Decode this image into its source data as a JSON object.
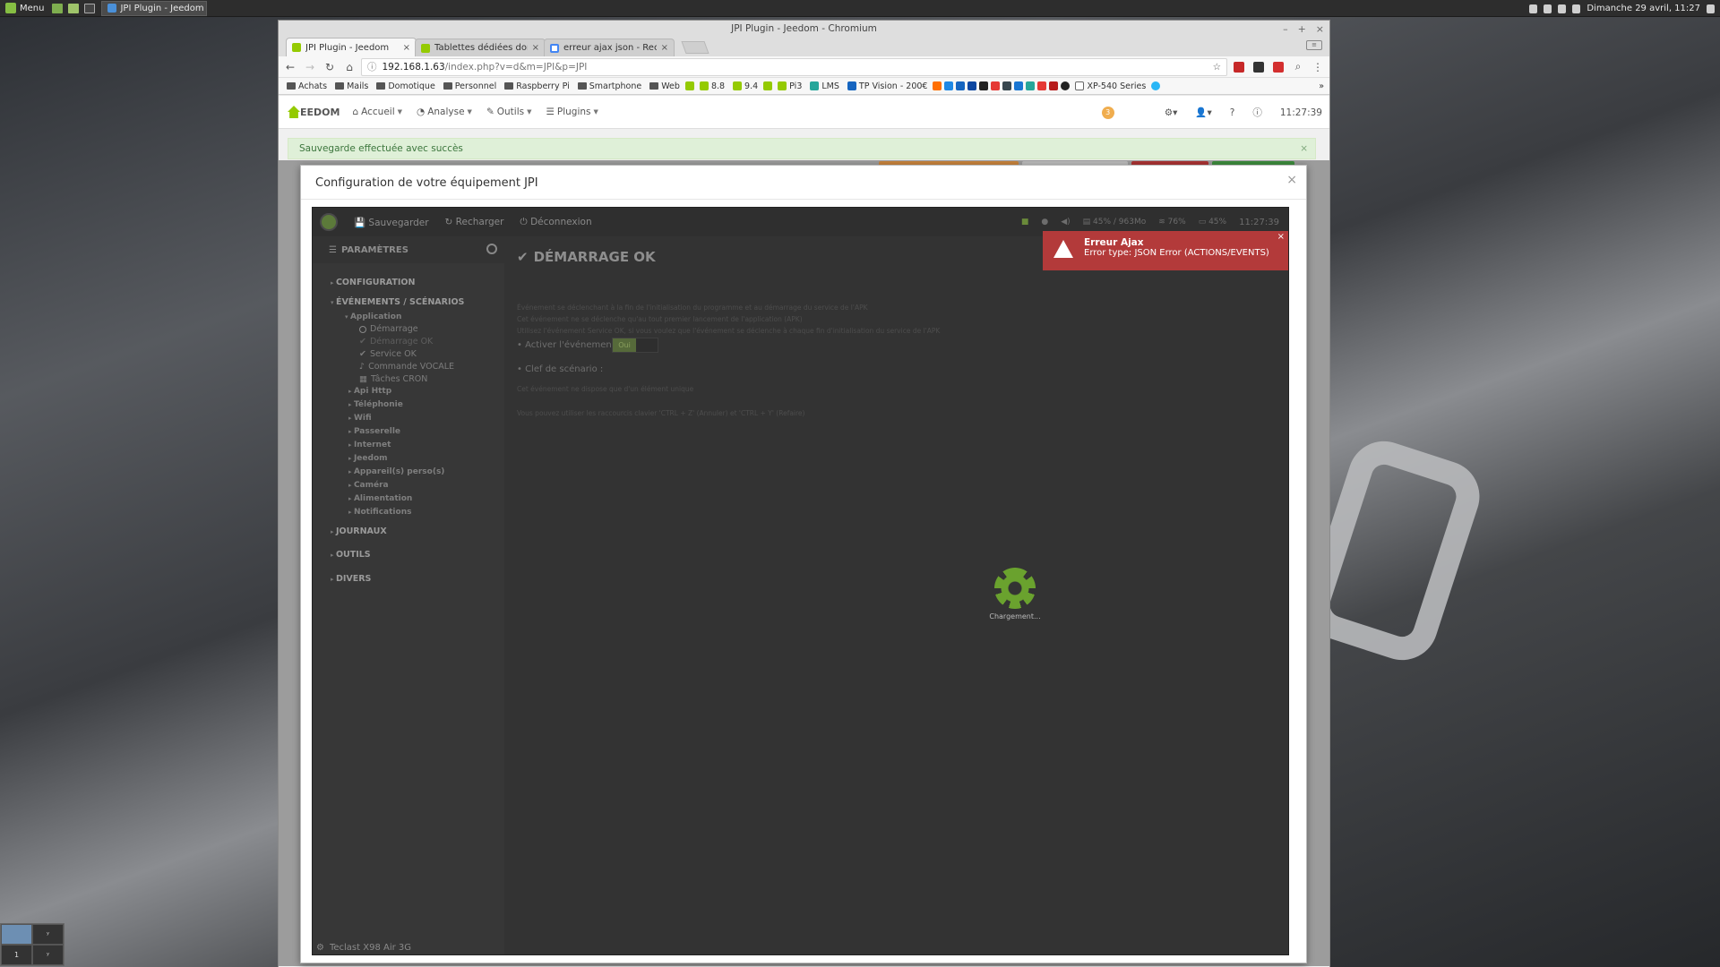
{
  "taskbar": {
    "menu_label": "Menu",
    "task_label": "JPI Plugin - Jeedom - ...",
    "clock": "Dimanche 29 avril, 11:27"
  },
  "workspace": {
    "cells": [
      "",
      "ʸ",
      "1",
      "ʸ"
    ]
  },
  "browser": {
    "window_title": "JPI Plugin - Jeedom - Chromium",
    "tabs": [
      {
        "label": "JPI Plugin - Jeedom",
        "active": true
      },
      {
        "label": "Tablettes dédiées dom",
        "active": false
      },
      {
        "label": "erreur ajax json - Reche",
        "active": false
      }
    ],
    "url_host": "192.168.1.63",
    "url_path": "/index.php?v=d&m=JPI&p=JPI",
    "bookmarks": [
      {
        "label": "Achats",
        "type": "folder"
      },
      {
        "label": "Mails",
        "type": "folder"
      },
      {
        "label": "Domotique",
        "type": "folder"
      },
      {
        "label": "Personnel",
        "type": "folder"
      },
      {
        "label": "Raspberry Pi",
        "type": "folder"
      },
      {
        "label": "Smartphone",
        "type": "folder"
      },
      {
        "label": "Web",
        "type": "folder"
      },
      {
        "label": "8.8",
        "type": "link"
      },
      {
        "label": "9.4",
        "type": "link"
      },
      {
        "label": "Pi3",
        "type": "link"
      },
      {
        "label": "LMS",
        "type": "link"
      },
      {
        "label": "TP Vision - 200€",
        "type": "link"
      },
      {
        "label": "XP-540 Series",
        "type": "link"
      }
    ],
    "bookmarks_more": "»"
  },
  "jeedom": {
    "logo_text": "EEDOM",
    "nav": [
      "Accueil",
      "Analyse",
      "Outils",
      "Plugins"
    ],
    "badge_count": "3",
    "time": "11:27:39",
    "alert": "Sauvegarde effectuée avec succès",
    "alert_close": "×"
  },
  "modal": {
    "title": "Configuration de votre équipement JPI",
    "close": "×",
    "app": {
      "toolbar": {
        "save": "Sauvegarder",
        "reload": "Recharger",
        "logout": "Déconnexion",
        "ram": "45% / 963Mo",
        "wifi": "76%",
        "battery": "45%",
        "time": "11:27:39"
      },
      "sidebar": {
        "header": "PARAMÈTRES",
        "configuration": "CONFIGURATION",
        "events": "ÉVÉNEMENTS / SCÉNARIOS",
        "application": "Application",
        "leaves": [
          "Démarrage",
          "Démarrage OK",
          "Service OK",
          "Commande VOCALE",
          "Tâches CRON"
        ],
        "subs": [
          "Api Http",
          "Téléphonie",
          "Wifi",
          "Passerelle",
          "Internet",
          "Jeedom",
          "Appareil(s) perso(s)",
          "Caméra",
          "Alimentation",
          "Notifications"
        ],
        "journaux": "JOURNAUX",
        "outils": "OUTILS",
        "divers": "DIVERS",
        "device": "Teclast X98 Air 3G"
      },
      "content": {
        "title": "DÉMARRAGE OK",
        "note1": "Événement se déclenchant à la fin de l'initialisation du programme et au démarrage du service de l'APK",
        "note2": "Cet événement ne se déclenche qu'au tout premier lancement de l'application (APK)",
        "note3": "Utilisez l'événement Service OK, si vous voulez que l'événement se déclenche à chaque fin d'initialisation du service de l'APK",
        "activate_label": "• Activer l'événement :",
        "toggle_on": "Oui",
        "scenario_label": "• Clef de scénario :",
        "note4": "Cet événement ne dispose que d'un élément unique",
        "note5": "Vous pouvez utiliser les raccourcis clavier 'CTRL + Z' (Annuler) et 'CTRL + Y' (Refaire)",
        "loading": "Chargement..."
      },
      "error": {
        "title": "Erreur Ajax",
        "message": "Error type: JSON Error (ACTIONS/EVENTS)",
        "close": "×"
      }
    }
  }
}
